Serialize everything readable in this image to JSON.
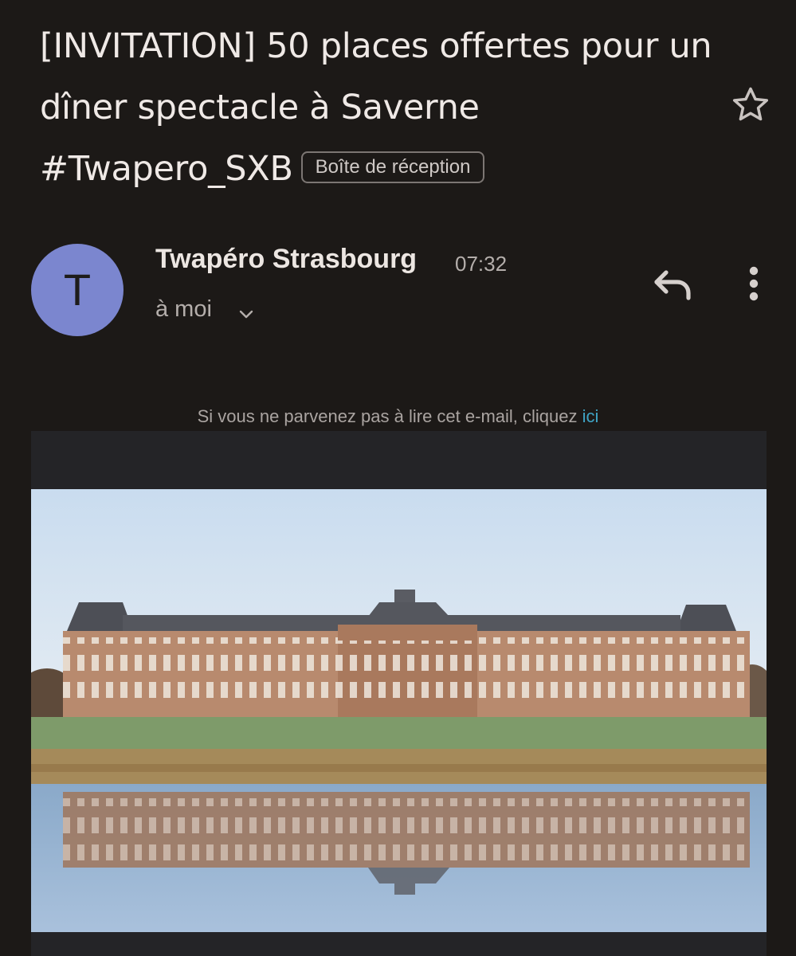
{
  "email": {
    "subject": "[INVITATION] 50 places offertes pour un dîner spectacle à Saverne #Twapero_SXB",
    "label": "Boîte de réception",
    "star_icon": "star-outline-icon",
    "sender": {
      "initial": "T",
      "name": "Twapéro Strasbourg",
      "time": "07:32",
      "recipient": "à moi",
      "avatar_color": "#7b86cf"
    },
    "actions": {
      "reply_icon": "reply-icon",
      "more_icon": "more-vert-icon"
    },
    "body": {
      "view_online_text": "Si vous ne parvenez pas à lire cet e-mail, cliquez",
      "view_online_link": "ici",
      "link_color": "#3fa3c4"
    }
  },
  "theme": {
    "background": "#1c1917",
    "text": "#ece6e2",
    "secondary_text": "#b4aeab"
  }
}
